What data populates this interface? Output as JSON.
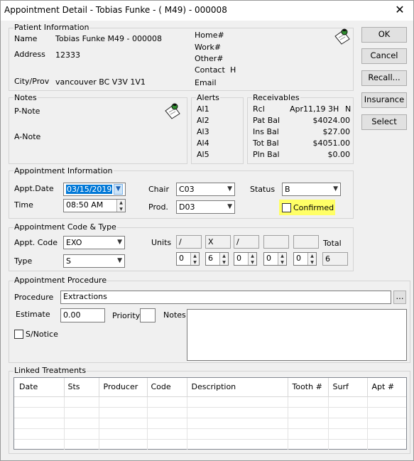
{
  "window": {
    "title": "Appointment Detail - Tobias Funke - ( M49) - 000008",
    "close": "✕"
  },
  "buttons": {
    "ok": "OK",
    "cancel": "Cancel",
    "recall": "Recall...",
    "insurance": "Insurance",
    "select": "Select"
  },
  "patient": {
    "group": "Patient Information",
    "name_label": "Name",
    "name": "Tobias Funke  M49 - 000008",
    "address_label": "Address",
    "address": "12333",
    "city_label": "City/Prov",
    "city": "vancouver BC V3V 1V1",
    "home_label": "Home#",
    "work_label": "Work#",
    "other_label": "Other#",
    "contact_label": "Contact",
    "contact_value": "H",
    "email_label": "Email"
  },
  "notes": {
    "group": "Notes",
    "pnote": "P-Note",
    "anote": "A-Note"
  },
  "alerts": {
    "group": "Alerts",
    "items": [
      "Al1",
      "Al2",
      "Al3",
      "Al4",
      "Al5"
    ]
  },
  "receivables": {
    "group": "Receivables",
    "rcl_label": "Rcl",
    "rcl_date": "Apr11,19",
    "rcl_interval": "3H",
    "rcl_flag": "N",
    "pat_label": "Pat Bal",
    "pat_value": "$4024.00",
    "ins_label": "Ins Bal",
    "ins_value": "$27.00",
    "tot_label": "Tot Bal",
    "tot_value": "$4051.00",
    "pln_label": "Pln Bal",
    "pln_value": "$0.00"
  },
  "appt": {
    "group": "Appointment Information",
    "date_label": "Appt.Date",
    "date": "03/15/2019",
    "time_label": "Time",
    "time": "08:50 AM",
    "chair_label": "Chair",
    "chair": "C03",
    "prod_label": "Prod.",
    "prod": "D03",
    "status_label": "Status",
    "status": "B",
    "confirmed_label": "Confirmed"
  },
  "code": {
    "group": "Appointment Code & Type",
    "code_label": "Appt. Code",
    "code": "EXO",
    "type_label": "Type",
    "type": "S",
    "units_label": "Units",
    "unit_boxes": [
      "/",
      "X",
      "/",
      "",
      ""
    ],
    "unit_values": [
      "0",
      "6",
      "0",
      "0",
      "0"
    ],
    "total_label": "Total",
    "total": "6"
  },
  "procedure": {
    "group": "Appointment Procedure",
    "proc_label": "Procedure",
    "proc": "Extractions",
    "browse": "...",
    "estimate_label": "Estimate",
    "estimate": "0.00",
    "priority_label": "Priority",
    "priority": "",
    "notes_label": "Notes",
    "snotice_label": "S/Notice"
  },
  "linked": {
    "group": "Linked Treatments",
    "columns": [
      "Date",
      "Sts",
      "Producer",
      "Code",
      "Description",
      "Tooth #",
      "Surf",
      "Apt #"
    ]
  },
  "icons": {
    "patient": "clipboard-icon",
    "notes": "clipboard-icon",
    "combo": "chevron-down-icon"
  },
  "colors": {
    "highlight": "#ffff66",
    "selection": "#0078d7"
  }
}
